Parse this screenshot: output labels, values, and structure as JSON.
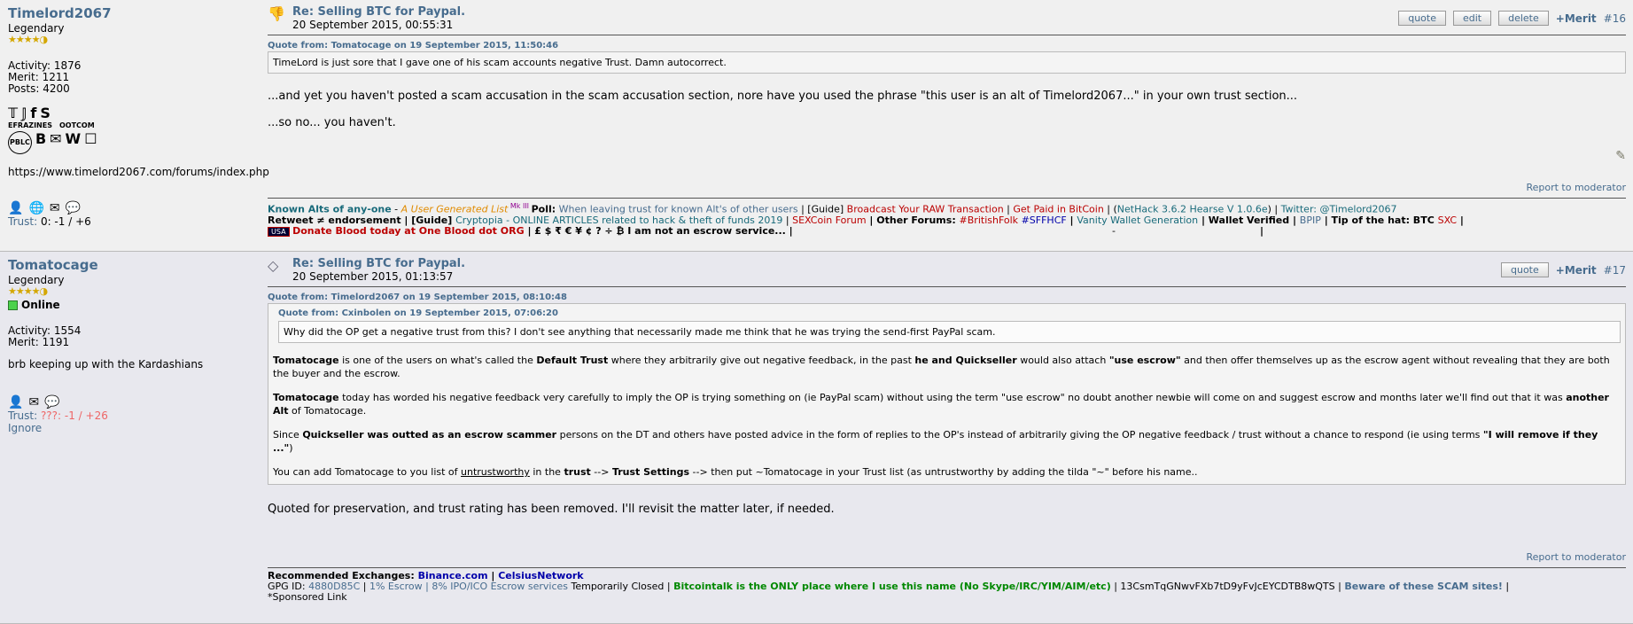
{
  "posts": [
    {
      "poster": {
        "name": "Timelord2067",
        "rank": "Legendary",
        "stars": "★★★★◑",
        "activity": "Activity: 1876",
        "merit": "Merit: 1211",
        "posts": "Posts: 4200",
        "badges_row1": [
          "𝕋",
          "𝕁",
          "f",
          "S"
        ],
        "badges_row1_captions": [
          "EFRAZINES",
          "OOTCOM"
        ],
        "badges_row2": [
          "PBLC",
          "B",
          "✉",
          "W",
          "☐"
        ],
        "website": "https://www.timelord2067.com/forums/index.php",
        "trust_label": "Trust:",
        "trust_value": "0: -1 / +6"
      },
      "subject": "Re: Selling BTC for Paypal.",
      "date": "20 September 2015, 00:55:31",
      "buttons": [
        "quote",
        "edit",
        "delete"
      ],
      "merit_link": "+Merit",
      "post_number": "#16",
      "quote_header": "Quote from: Tomatocage on 19 September 2015, 11:50:46",
      "quote_text": "TimeLord is just sore that I gave one of his scam accounts negative Trust. Damn autocorrect.",
      "body": [
        "...and yet you haven't posted a scam accusation in the scam accusation section, nore have you used the phrase \"this user is an alt of Timelord2067...\" in your own trust section...",
        "...so no... you haven't."
      ],
      "report": "Report to moderator",
      "signature": {
        "l1": [
          "Known Alts of any-one",
          " - ",
          "A User Generated List",
          " Mk III ",
          "Poll:",
          " When leaving trust for known Alt's of other users",
          " | [Guide] ",
          "Broadcast Your RAW Transaction",
          " | ",
          "Get Paid in BitCoin",
          " | (",
          "NetHack 3.6.2 Hearse V 1.0.6e",
          ") | ",
          "Twitter: @Timelord2067"
        ],
        "l2": [
          "Retweet ≠ endorsement | [Guide] ",
          "Cryptopia - ONLINE ARTICLES related to hack & theft of funds 2019",
          " | ",
          "SEXCoin Forum",
          " | Other Forums: ",
          "#BritishFolk",
          " ",
          "#SFFHCF",
          " | ",
          "Vanity Wallet Generation",
          " | Wallet Verified | ",
          "BPIP",
          " | Tip of the hat: BTC ",
          "SXC",
          " |"
        ],
        "l3_flag": "USA",
        "l3": [
          "Donate Blood today at One Blood dot ORG",
          " | £ $ ₹ € ¥ ¢ ? ÷ ₿ I am not an escrow service... |",
          "-",
          "|"
        ]
      }
    },
    {
      "poster": {
        "name": "Tomatocage",
        "rank": "Legendary",
        "stars": "★★★★◑",
        "online": "Online",
        "activity": "Activity: 1554",
        "merit": "Merit: 1191",
        "text": "brb keeping up with the Kardashians",
        "trust_label": "Trust:",
        "trust_value": "???: -1 / +26",
        "ignore": "Ignore"
      },
      "subject": "Re: Selling BTC for Paypal.",
      "date": "20 September 2015, 01:13:57",
      "buttons": [
        "quote"
      ],
      "merit_link": "+Merit",
      "post_number": "#17",
      "quote_header": "Quote from: Timelord2067 on 19 September 2015, 08:10:48",
      "inner_quote_header": "Quote from: Cxinbolen on 19 September 2015, 07:06:20",
      "inner_quote_text": "Why did the OP get a negative trust from this? I don't see anything that necessarily made me think that he was trying the send-first PayPal scam.",
      "quote_paragraphs": {
        "p1": [
          "Tomatocage",
          " is one of the users on what's called the ",
          "Default Trust",
          " where they arbitrarily give out negative feedback, in the past ",
          "he and Quickseller",
          " would also attach ",
          "\"use escrow\"",
          " and then offer themselves up as the escrow agent without revealing that they are both the buyer and the escrow."
        ],
        "p2": [
          "Tomatocage",
          " today has worded his negative feedback very carefully to imply the OP is trying something on (ie PayPal scam) without using the term \"use escrow\" no doubt another newbie will come on and suggest escrow and months later we'll find out that it was ",
          "another Alt",
          " of Tomatocage."
        ],
        "p3": [
          "Since ",
          "Quickseller was outted as an escrow scammer",
          " persons on the DT and others have posted advice in the form of replies to the OP's instead of arbitrarily giving the OP negative feedback / trust without a chance to respond (ie using terms ",
          "\"I will remove if they ...\"",
          ")"
        ],
        "p4": [
          "You can add Tomatocage to you list of ",
          "untrustworthy",
          " in the ",
          "trust",
          " --> ",
          "Trust Settings",
          " --> then put ~Tomatocage in your Trust list (as untrustworthy by adding the tilda \"~\" before his name.."
        ]
      },
      "body": "Quoted for preservation, and trust rating has been removed. I'll revisit the matter later, if needed.",
      "report": "Report to moderator",
      "signature": {
        "l1": [
          "Recommended Exchanges: ",
          "Binance.com",
          " | ",
          "CelsiusNetwork"
        ],
        "l2": [
          "GPG ID: ",
          "4880D85C",
          " | ",
          "1% Escrow | 8% IPO/ICO Escrow services",
          " Temporarily Closed | ",
          "Bitcointalk is the ONLY place where I use this name (No Skype/IRC/YIM/AIM/etc)",
          " | 13CsmTqGNwvFXb7tD9yFvJcEYCDTB8wQTS | ",
          "Beware of these SCAM sites!",
          " |"
        ],
        "l3": "*Sponsored Link"
      }
    }
  ],
  "icons": [
    "profile-icon",
    "www-icon",
    "email-icon",
    "pm-icon",
    "edit-post-icon"
  ]
}
